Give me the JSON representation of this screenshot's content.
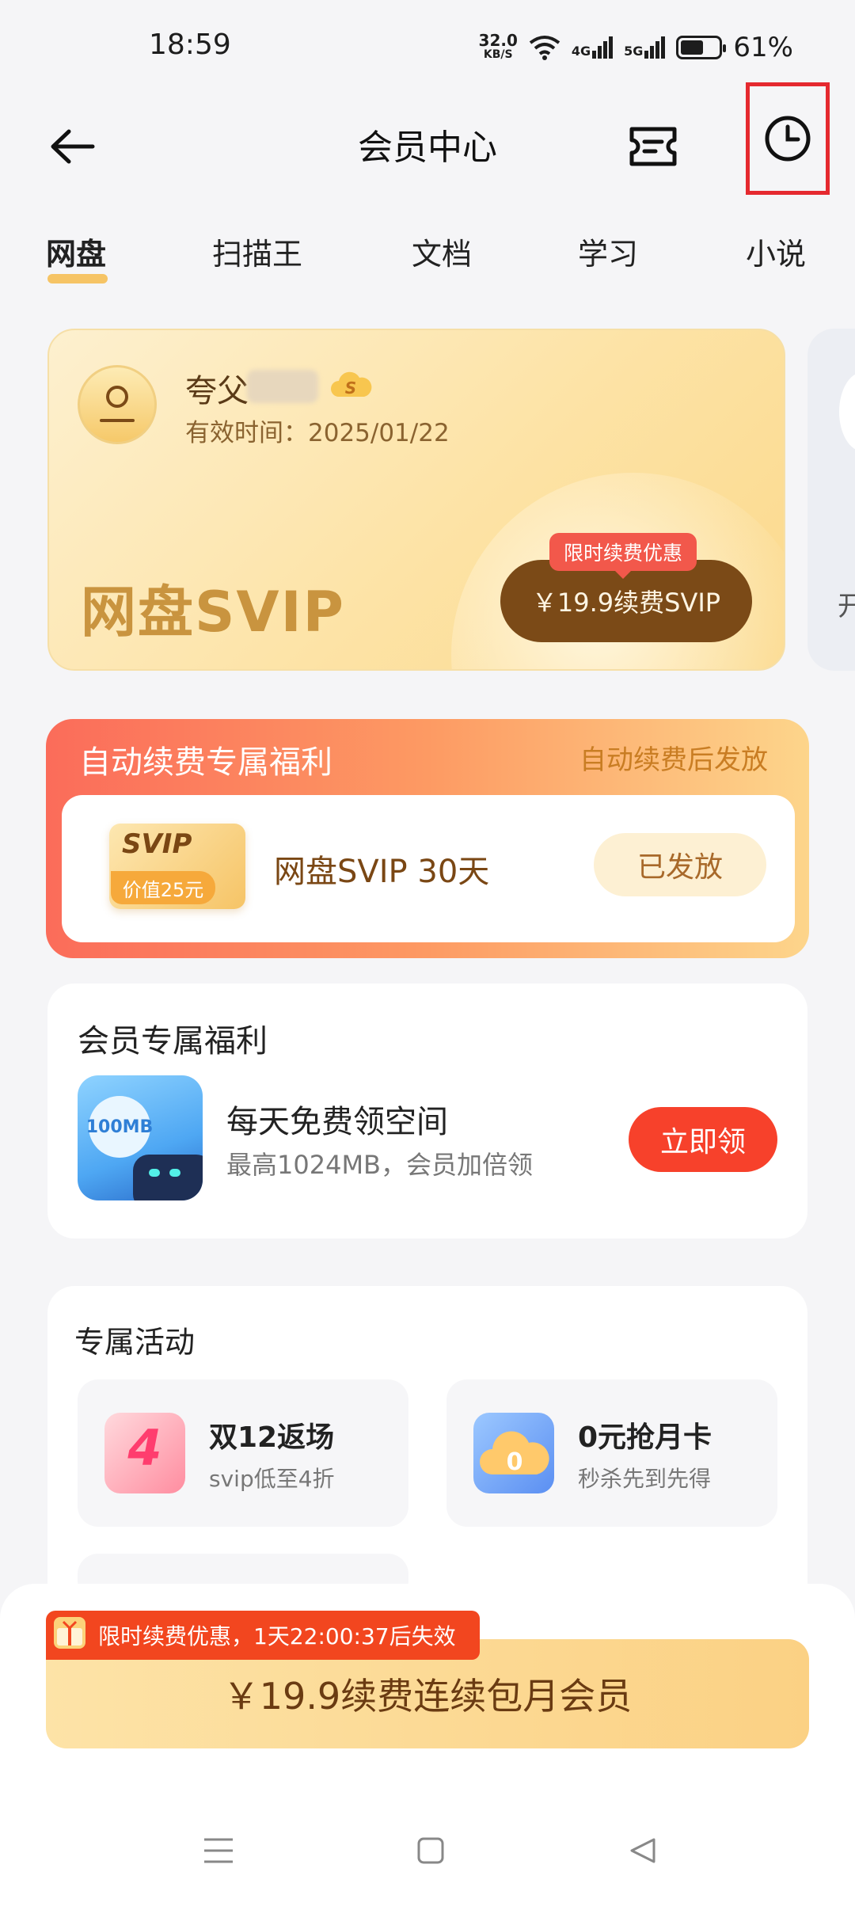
{
  "status_bar": {
    "time": "18:59",
    "net_speed_value": "32.0",
    "net_speed_unit": "KB/S",
    "signal1": "4G",
    "signal2": "5G",
    "battery_pct": "61%",
    "battery_level": 0.61
  },
  "header": {
    "title": "会员中心",
    "back_icon": "arrow-left-icon",
    "ticket_icon": "ticket-icon",
    "history_icon": "clock-icon"
  },
  "tabs": [
    "网盘",
    "扫描王",
    "文档",
    "学习",
    "小说"
  ],
  "member_card": {
    "username": "夸父",
    "expire_text": "有效时间：2025/01/22",
    "product_title": "网盘SVIP",
    "promo_tag": "限时续费优惠",
    "renew_button": "￥19.9续费SVIP",
    "badge_letter": "S",
    "side_card_text": "开"
  },
  "auto_renew": {
    "title": "自动续费专属福利",
    "subtitle": "自动续费后发放",
    "ticket_text": "SVIP",
    "ticket_value": "价值25元",
    "item_title": "网盘SVIP 30天",
    "status_button": "已发放"
  },
  "member_benefits": {
    "title": "会员专属福利",
    "icon_text": "100MB",
    "item_title": "每天免费领空间",
    "item_subtitle": "最高1024MB，会员加倍领",
    "claim_button": "立即领"
  },
  "activities": {
    "title": "专属活动",
    "items": [
      {
        "title": "双12返场",
        "subtitle": "svip低至4折",
        "icon_text": "4",
        "icon": "sale-4-off-icon"
      },
      {
        "title": "0元抢月卡",
        "subtitle": "秒杀先到先得",
        "icon_text": "0",
        "icon": "cloud-zero-icon"
      }
    ]
  },
  "bottom_cta": {
    "countdown": "限时续费优惠，1天22:00:37后失效",
    "button": "￥19.9续费连续包月会员"
  },
  "colors": {
    "accent": "#f7412b",
    "gold": "#c9943f",
    "brown": "#7b4a17",
    "highlight_box": "#e5292f"
  }
}
